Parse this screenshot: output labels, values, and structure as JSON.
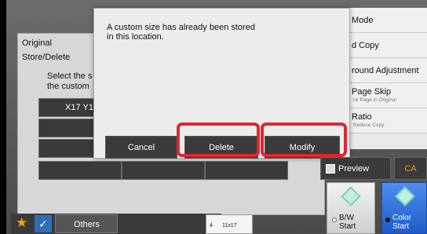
{
  "right_menu": {
    "items": [
      {
        "label": "Mode",
        "sub": ""
      },
      {
        "label": "d Copy",
        "sub": ""
      },
      {
        "label": "round Adjustment",
        "sub": ""
      },
      {
        "label": "Page Skip",
        "sub": "nk Page in Original"
      },
      {
        "label": "Ratio",
        "sub": "Reduce Copy"
      }
    ]
  },
  "back_panel": {
    "title_line1": "Original",
    "title_line2": "Store/Delete",
    "text_line1": "Select the s",
    "text_line2": "the custom",
    "size_button": "X17 Y1"
  },
  "dialog": {
    "message_line1": "A custom size has already been stored",
    "message_line2": "in this location.",
    "cancel_label": "Cancel",
    "delete_label": "Delete",
    "modify_label": "Modify"
  },
  "preview_label": "Preview",
  "ca_label": "CA",
  "start_bw": {
    "line1": "B/W",
    "line2": "Start"
  },
  "start_color": {
    "line1": "Color",
    "line2": "Start"
  },
  "bottom": {
    "others_label": "Others",
    "tray_number": "4",
    "paper_size": "11x17"
  },
  "colors": {
    "highlight": "#e0262f",
    "ca_text": "#e7a300",
    "start_color_bg": "#2f6fdc"
  }
}
